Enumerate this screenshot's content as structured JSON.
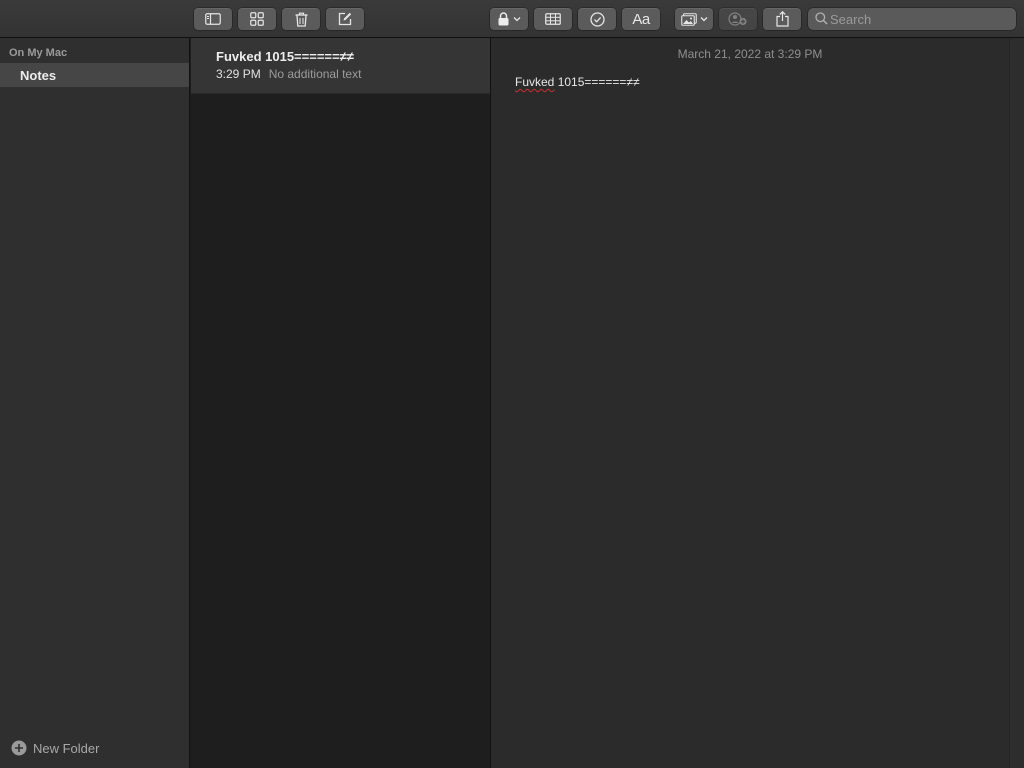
{
  "toolbar": {
    "buttons": [
      {
        "icon": "sidebar-toggle-icon"
      },
      {
        "icon": "gallery-grid-icon"
      },
      {
        "icon": "trash-icon"
      },
      {
        "icon": "compose-icon"
      },
      {
        "icon": "lock-icon"
      },
      {
        "icon": "table-icon"
      },
      {
        "icon": "checklist-icon"
      },
      {
        "icon": "format-text-icon",
        "label": "Aa"
      },
      {
        "icon": "media-icon"
      },
      {
        "icon": "collaborate-icon"
      },
      {
        "icon": "share-icon"
      }
    ],
    "search": {
      "placeholder": "Search"
    }
  },
  "sidebar": {
    "section_label": "On My Mac",
    "items": [
      {
        "label": "Notes"
      }
    ],
    "new_folder_label": "New Folder"
  },
  "note_list": {
    "notes": [
      {
        "title": "Fuvked 1015======≠≠",
        "time": "3:29 PM",
        "preview": "No additional text"
      }
    ]
  },
  "editor": {
    "date": "March 21, 2022 at 3:29 PM",
    "misspelled_word": "Fuvked",
    "body_rest": " 1015======≠≠"
  },
  "colors": {
    "background": "#1e1e1e",
    "toolbar": "#383838",
    "sidebar": "#2f2f2f",
    "selected_item": "#464646",
    "editor": "#2b2b2b",
    "button": "#5b5b5b",
    "spellcheck_underline": "#d0302f"
  }
}
